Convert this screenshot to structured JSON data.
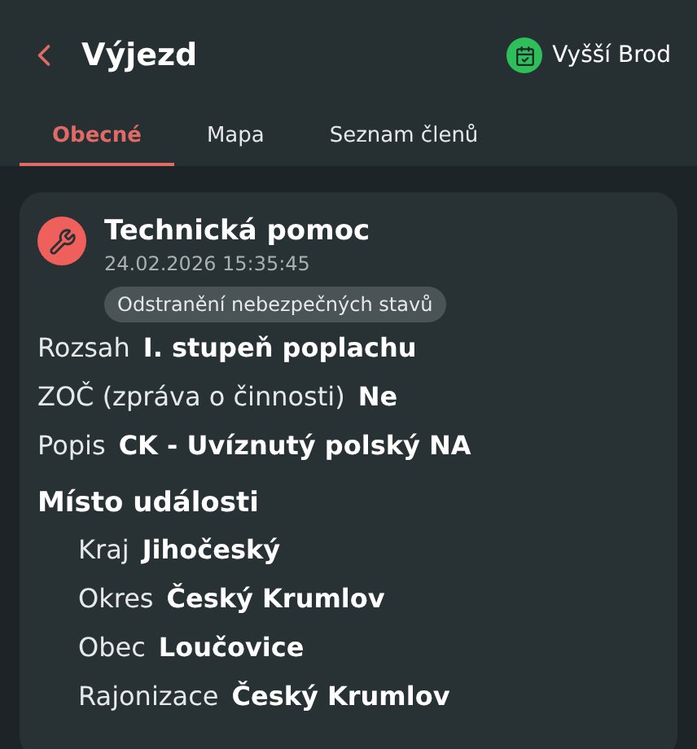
{
  "header": {
    "title": "Výjezd",
    "unit": "Vyšší Brod"
  },
  "tabs": [
    {
      "label": "Obecné",
      "selected": true
    },
    {
      "label": "Mapa",
      "selected": false
    },
    {
      "label": "Seznam členů",
      "selected": false
    }
  ],
  "event": {
    "title": "Technická pomoc",
    "datetime": "24.02.2026 15:35:45",
    "tag": "Odstranění nebezpečných stavů",
    "fields": [
      {
        "label": "Rozsah",
        "value": "I. stupeň poplachu"
      },
      {
        "label": "ZOČ (zpráva o činnosti)",
        "value": "Ne"
      },
      {
        "label": "Popis",
        "value": "CK - Uvíznutý polský NA"
      }
    ],
    "location": {
      "heading": "Místo události",
      "fields": [
        {
          "label": "Kraj",
          "value": "Jihočeský"
        },
        {
          "label": "Okres",
          "value": "Český Krumlov"
        },
        {
          "label": "Obec",
          "value": "Loučovice"
        },
        {
          "label": "Rajonizace",
          "value": "Český Krumlov"
        }
      ]
    }
  }
}
